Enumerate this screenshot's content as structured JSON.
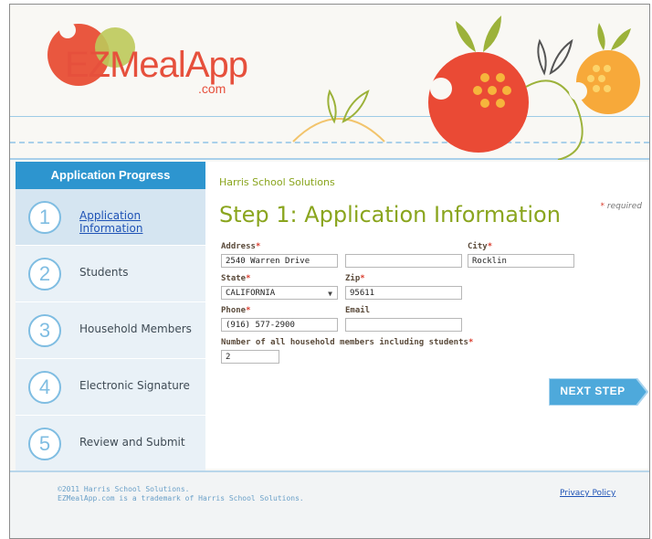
{
  "brand": {
    "logo_main": "EZMealApp",
    "logo_domain": ".com"
  },
  "sidebar": {
    "title": "Application Progress",
    "steps": [
      {
        "number": "1",
        "label": "Application Information",
        "active": true
      },
      {
        "number": "2",
        "label": "Students",
        "active": false
      },
      {
        "number": "3",
        "label": "Household Members",
        "active": false
      },
      {
        "number": "4",
        "label": "Electronic Signature",
        "active": false
      },
      {
        "number": "5",
        "label": "Review and Submit",
        "active": false
      }
    ]
  },
  "main": {
    "company": "Harris School Solutions",
    "title": "Step 1: Application Information",
    "required_note": "required",
    "fields": {
      "address_label": "Address",
      "address_line1": "2540 Warren Drive",
      "address_line2": "",
      "city_label": "City",
      "city_value": "Rocklin",
      "state_label": "State",
      "state_value": "CALIFORNIA",
      "zip_label": "Zip",
      "zip_value": "95611",
      "phone_label": "Phone",
      "phone_value": "(916) 577-2900",
      "email_label": "Email",
      "email_value": "",
      "household_label": "Number of all household members including students",
      "household_value": "2"
    },
    "next_button": "NEXT STEP"
  },
  "footer": {
    "copyright_line1": "©2011 Harris School Solutions.",
    "copyright_line2": "EZMealApp.com is a trademark of Harris School Solutions.",
    "privacy": "Privacy Policy"
  },
  "colors": {
    "accent_blue": "#2d95cf",
    "title_green": "#8aa51e",
    "brand_red": "#e6503c",
    "required_red": "#d93a2b"
  }
}
